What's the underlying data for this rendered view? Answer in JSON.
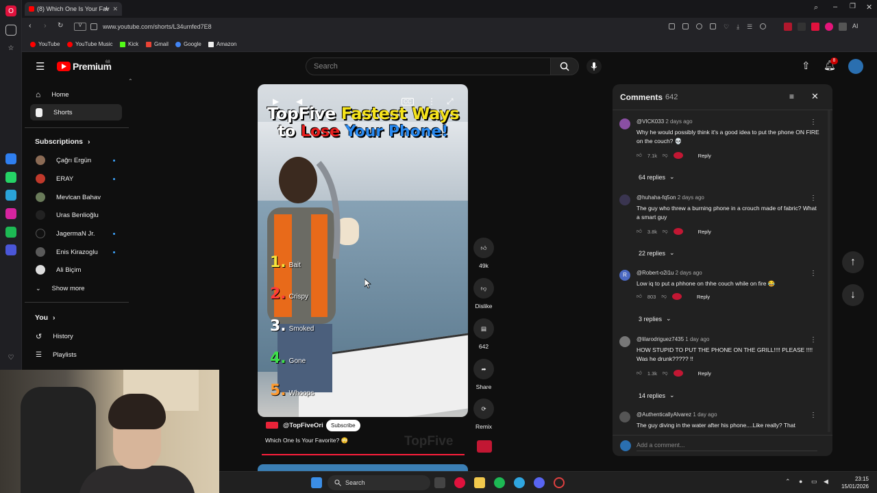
{
  "browser": {
    "tab_title": "(8) Which One Is Your Fav",
    "url": "www.youtube.com/shorts/L34umfed7E8",
    "bookmarks": [
      "YouTube",
      "YouTube Music",
      "Kick",
      "Gmail",
      "Google",
      "Amazon"
    ]
  },
  "header": {
    "logo_text": "Premium",
    "logo_badge": "68",
    "search_placeholder": "Search",
    "notification_count": "8"
  },
  "nav": {
    "home": "Home",
    "shorts": "Shorts",
    "subscriptions": "Subscriptions",
    "subs": [
      "Çağrı Ergün",
      "ERAY",
      "Mevlcan Bahav",
      "Uras Benlioğlu",
      "JagermaN Jr.",
      "Enis Kirazoglu",
      "Ali Biçim"
    ],
    "show_more": "Show more",
    "you": "You",
    "history": "History",
    "playlists": "Playlists"
  },
  "video": {
    "title_line1_a": "TopFive",
    "title_line1_b": "Fastest Ways",
    "title_line2_a": "to",
    "title_line2_b": "Lose",
    "title_line2_c": "Your Phone!",
    "ranks": [
      {
        "num": "1.",
        "label": "Bait",
        "color": "#f5e63c"
      },
      {
        "num": "2.",
        "label": "Crispy",
        "color": "#ff3a3a"
      },
      {
        "num": "3.",
        "label": "Smoked",
        "color": "#ffffff"
      },
      {
        "num": "4.",
        "label": "Gone",
        "color": "#3ee04a"
      },
      {
        "num": "5.",
        "label": "Whoops",
        "color": "#ff9a2e"
      }
    ],
    "channel": "@TopFiveOri",
    "subscribe": "Subscribe",
    "caption": "Which One Is Your Favorite? 😳",
    "watermark": "TopFive",
    "progress": 1.0
  },
  "actions": {
    "likes": "49k",
    "dislike": "Dislike",
    "comments": "642",
    "share": "Share",
    "remix": "Remix"
  },
  "comments": {
    "title": "Comments",
    "count": "642",
    "add_placeholder": "Add a comment...",
    "reply_label": "Reply",
    "items": [
      {
        "user": "@VICK033",
        "time": "2 days ago",
        "text": "Why he would possibly think it's a good idea to put the phone ON FIRE on the couch? 💀",
        "likes": "7.1k",
        "replies": "64 replies",
        "color": "#8a4fa3"
      },
      {
        "user": "@huhaha-fq5on",
        "time": "2 days ago",
        "text": "The guy who threw a burning phone in a crouch made of fabric? What a smart guy",
        "likes": "3.8k",
        "replies": "22 replies",
        "color": "#3a3550"
      },
      {
        "user": "@Robert-o2i1u",
        "time": "2 days ago",
        "text": "Low iq to put a phhone on thhe couch while on fire 😂",
        "likes": "803",
        "replies": "3 replies",
        "color": "#4b69c2"
      },
      {
        "user": "@lilarodriguez7435",
        "time": "1 day ago",
        "text": "HOW STUPID TO PUT THE PHONE ON THE GRILL!!!! PLEASE !!!! Was he drunk????? !!",
        "likes": "1.3k",
        "replies": "14 replies",
        "color": "#777777"
      },
      {
        "user": "@AuthenticallyAlvarez",
        "time": "1 day ago",
        "text": "The guy diving in the water after his phone....Like really? That",
        "likes": "",
        "replies": "",
        "color": "#555555"
      }
    ]
  },
  "taskbar": {
    "search": "Search",
    "time": "23:15",
    "date": "15/01/2026"
  }
}
